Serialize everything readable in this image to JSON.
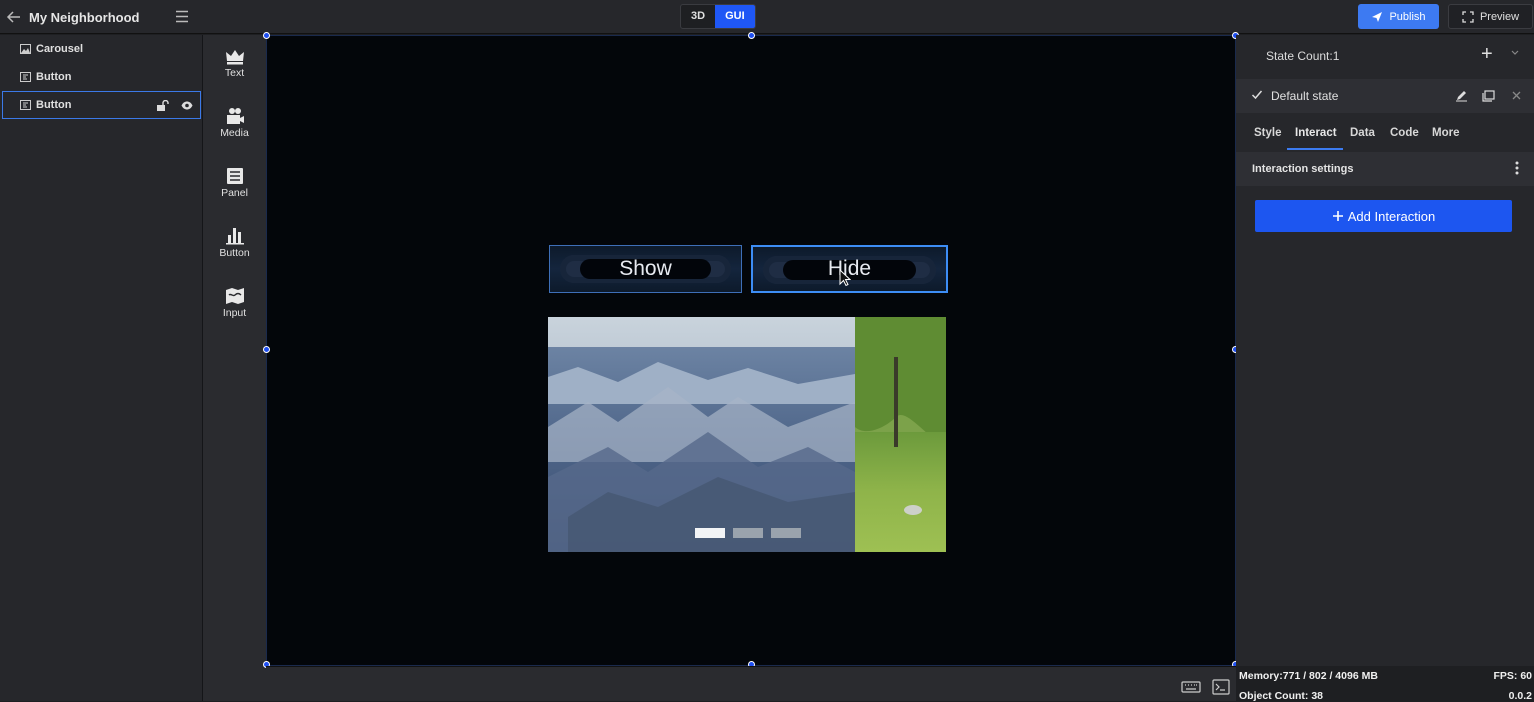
{
  "project": {
    "name": "My Neighborhood"
  },
  "mode_toggle": {
    "options": [
      "3D",
      "GUI"
    ],
    "selected": "GUI"
  },
  "header": {
    "publish_label": "Publish",
    "preview_label": "Preview"
  },
  "layers": [
    {
      "label": "Carousel",
      "icon": "image-icon"
    },
    {
      "label": "Button",
      "icon": "button-layer-icon"
    },
    {
      "label": "Button",
      "icon": "button-layer-icon",
      "selected": true
    }
  ],
  "tools": [
    {
      "label": "Text",
      "icon": "crown-icon"
    },
    {
      "label": "Media",
      "icon": "media-icon"
    },
    {
      "label": "Panel",
      "icon": "panel-icon"
    },
    {
      "label": "Button",
      "icon": "bar-chart-icon"
    },
    {
      "label": "Input",
      "icon": "map-icon"
    }
  ],
  "canvas": {
    "show_button": "Show",
    "hide_button": "Hide",
    "carousel_pages": 3,
    "carousel_active_page": 1
  },
  "properties": {
    "state_count_label": "State Count:1",
    "default_state": "Default state",
    "tabs": [
      "Style",
      "Interact",
      "Data",
      "Code",
      "More"
    ],
    "active_tab": "Interact",
    "section_title": "Interaction settings",
    "add_interaction_label": "Add Interaction"
  },
  "stats": {
    "memory": "Memory:771 / 802 / 4096 MB",
    "object_count": "Object Count: 38",
    "fps": "FPS: 60",
    "version": "0.0.2"
  },
  "colors": {
    "accent": "#1d56f0",
    "publish": "#3d7af2",
    "canvas_bg": "#03060a"
  }
}
